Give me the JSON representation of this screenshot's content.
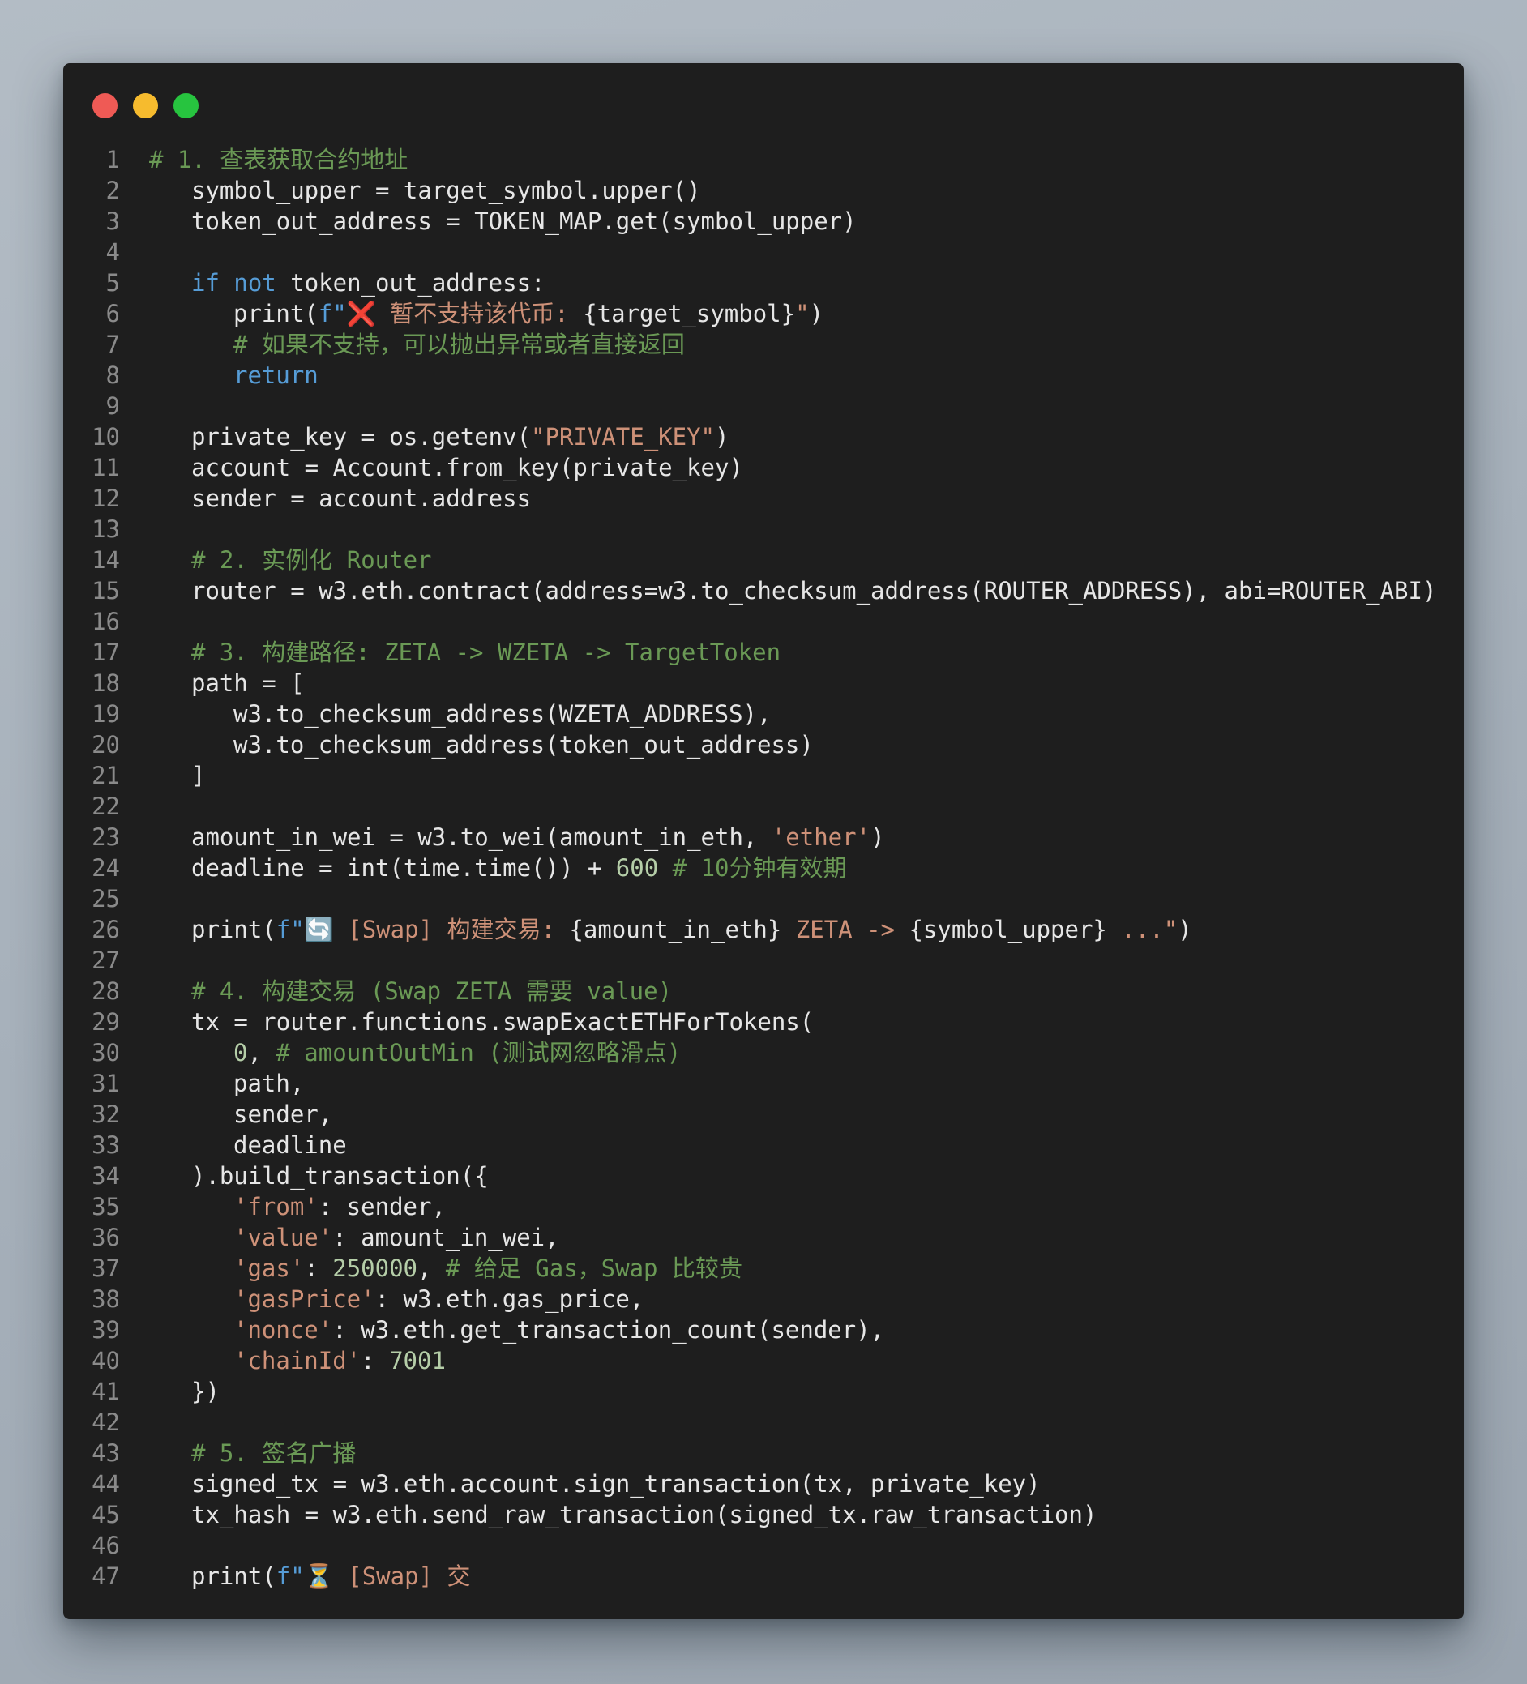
{
  "window": {
    "controls": [
      {
        "name": "close",
        "color": "#ef5a55"
      },
      {
        "name": "minimize",
        "color": "#f6bb2e"
      },
      {
        "name": "maximize",
        "color": "#27c43f"
      }
    ]
  },
  "editor": {
    "language": "python",
    "colors": {
      "background": "#1e1e1e",
      "text": "#e6e6e6",
      "line_number": "#8a8a8a",
      "comment": "#6a9955",
      "keyword": "#569cd6",
      "string": "#ce9178",
      "number": "#b5cea8"
    },
    "lines": [
      {
        "no": "1",
        "indent": 0,
        "tokens": [
          {
            "t": "# 1. 查表获取合约地址",
            "c": "comment"
          }
        ]
      },
      {
        "no": "2",
        "indent": 4,
        "tokens": [
          {
            "t": "symbol_upper = target_symbol.upper()"
          }
        ]
      },
      {
        "no": "3",
        "indent": 4,
        "tokens": [
          {
            "t": "token_out_address = TOKEN_MAP.get(symbol_upper)"
          }
        ]
      },
      {
        "no": "4",
        "indent": 0,
        "tokens": []
      },
      {
        "no": "5",
        "indent": 4,
        "tokens": [
          {
            "t": "if",
            "c": "keyword"
          },
          {
            "t": " "
          },
          {
            "t": "not",
            "c": "keyword"
          },
          {
            "t": " token_out_address:"
          }
        ]
      },
      {
        "no": "6",
        "indent": 8,
        "tokens": [
          {
            "t": "print("
          },
          {
            "t": "f\"",
            "c": "keyword"
          },
          {
            "t": "❌ 暂不支持该代币: ",
            "c": "string"
          },
          {
            "t": "{target_symbol}"
          },
          {
            "t": "\"",
            "c": "string"
          },
          {
            "t": ")"
          }
        ]
      },
      {
        "no": "7",
        "indent": 8,
        "tokens": [
          {
            "t": "# 如果不支持，可以抛出异常或者直接返回",
            "c": "comment"
          }
        ]
      },
      {
        "no": "8",
        "indent": 8,
        "tokens": [
          {
            "t": "return",
            "c": "keyword"
          }
        ]
      },
      {
        "no": "9",
        "indent": 0,
        "tokens": []
      },
      {
        "no": "10",
        "indent": 4,
        "tokens": [
          {
            "t": "private_key = os.getenv("
          },
          {
            "t": "\"PRIVATE_KEY\"",
            "c": "string"
          },
          {
            "t": ")"
          }
        ]
      },
      {
        "no": "11",
        "indent": 4,
        "tokens": [
          {
            "t": "account = Account.from_key(private_key)"
          }
        ]
      },
      {
        "no": "12",
        "indent": 4,
        "tokens": [
          {
            "t": "sender = account.address"
          }
        ]
      },
      {
        "no": "13",
        "indent": 0,
        "tokens": []
      },
      {
        "no": "14",
        "indent": 4,
        "tokens": [
          {
            "t": "# 2. 实例化 Router",
            "c": "comment"
          }
        ]
      },
      {
        "no": "15",
        "indent": 4,
        "tokens": [
          {
            "t": "router = w3.eth.contract(address=w3.to_checksum_address(ROUTER_ADDRESS), abi=ROUTER_ABI)"
          }
        ]
      },
      {
        "no": "16",
        "indent": 0,
        "tokens": []
      },
      {
        "no": "17",
        "indent": 4,
        "tokens": [
          {
            "t": "# 3. 构建路径: ZETA -> WZETA -> TargetToken",
            "c": "comment"
          }
        ]
      },
      {
        "no": "18",
        "indent": 4,
        "tokens": [
          {
            "t": "path = ["
          }
        ]
      },
      {
        "no": "19",
        "indent": 8,
        "tokens": [
          {
            "t": "w3.to_checksum_address(WZETA_ADDRESS),"
          }
        ]
      },
      {
        "no": "20",
        "indent": 8,
        "tokens": [
          {
            "t": "w3.to_checksum_address(token_out_address)"
          }
        ]
      },
      {
        "no": "21",
        "indent": 4,
        "tokens": [
          {
            "t": "]"
          }
        ]
      },
      {
        "no": "22",
        "indent": 0,
        "tokens": []
      },
      {
        "no": "23",
        "indent": 4,
        "tokens": [
          {
            "t": "amount_in_wei = w3.to_wei(amount_in_eth, "
          },
          {
            "t": "'ether'",
            "c": "string"
          },
          {
            "t": ")"
          }
        ]
      },
      {
        "no": "24",
        "indent": 4,
        "tokens": [
          {
            "t": "deadline = int(time.time()) + "
          },
          {
            "t": "600",
            "c": "number"
          },
          {
            "t": " "
          },
          {
            "t": "# 10分钟有效期",
            "c": "comment"
          }
        ]
      },
      {
        "no": "25",
        "indent": 0,
        "tokens": []
      },
      {
        "no": "26",
        "indent": 4,
        "tokens": [
          {
            "t": "print("
          },
          {
            "t": "f\"",
            "c": "keyword"
          },
          {
            "t": "🔄 [Swap] 构建交易: ",
            "c": "string"
          },
          {
            "t": "{amount_in_eth}"
          },
          {
            "t": " ZETA -> ",
            "c": "string"
          },
          {
            "t": "{symbol_upper}"
          },
          {
            "t": " ...\"",
            "c": "string"
          },
          {
            "t": ")"
          }
        ]
      },
      {
        "no": "27",
        "indent": 0,
        "tokens": []
      },
      {
        "no": "28",
        "indent": 4,
        "tokens": [
          {
            "t": "# 4. 构建交易 (Swap ZETA 需要 value)",
            "c": "comment"
          }
        ]
      },
      {
        "no": "29",
        "indent": 4,
        "tokens": [
          {
            "t": "tx = router.functions.swapExactETHForTokens("
          }
        ]
      },
      {
        "no": "30",
        "indent": 8,
        "tokens": [
          {
            "t": "0",
            "c": "number"
          },
          {
            "t": ", "
          },
          {
            "t": "# amountOutMin (测试网忽略滑点)",
            "c": "comment"
          }
        ]
      },
      {
        "no": "31",
        "indent": 8,
        "tokens": [
          {
            "t": "path,"
          }
        ]
      },
      {
        "no": "32",
        "indent": 8,
        "tokens": [
          {
            "t": "sender,"
          }
        ]
      },
      {
        "no": "33",
        "indent": 8,
        "tokens": [
          {
            "t": "deadline"
          }
        ]
      },
      {
        "no": "34",
        "indent": 4,
        "tokens": [
          {
            "t": ").build_transaction({"
          }
        ]
      },
      {
        "no": "35",
        "indent": 8,
        "tokens": [
          {
            "t": "'from'",
            "c": "string"
          },
          {
            "t": ": sender,"
          }
        ]
      },
      {
        "no": "36",
        "indent": 8,
        "tokens": [
          {
            "t": "'value'",
            "c": "string"
          },
          {
            "t": ": amount_in_wei,"
          }
        ]
      },
      {
        "no": "37",
        "indent": 8,
        "tokens": [
          {
            "t": "'gas'",
            "c": "string"
          },
          {
            "t": ": "
          },
          {
            "t": "250000",
            "c": "number"
          },
          {
            "t": ", "
          },
          {
            "t": "# 给足 Gas，Swap 比较贵",
            "c": "comment"
          }
        ]
      },
      {
        "no": "38",
        "indent": 8,
        "tokens": [
          {
            "t": "'gasPrice'",
            "c": "string"
          },
          {
            "t": ": w3.eth.gas_price,"
          }
        ]
      },
      {
        "no": "39",
        "indent": 8,
        "tokens": [
          {
            "t": "'nonce'",
            "c": "string"
          },
          {
            "t": ": w3.eth.get_transaction_count(sender),"
          }
        ]
      },
      {
        "no": "40",
        "indent": 8,
        "tokens": [
          {
            "t": "'chainId'",
            "c": "string"
          },
          {
            "t": ": "
          },
          {
            "t": "7001",
            "c": "number"
          }
        ]
      },
      {
        "no": "41",
        "indent": 4,
        "tokens": [
          {
            "t": "})"
          }
        ]
      },
      {
        "no": "42",
        "indent": 0,
        "tokens": []
      },
      {
        "no": "43",
        "indent": 4,
        "tokens": [
          {
            "t": "# 5. 签名广播",
            "c": "comment"
          }
        ]
      },
      {
        "no": "44",
        "indent": 4,
        "tokens": [
          {
            "t": "signed_tx = w3.eth.account.sign_transaction(tx, private_key)"
          }
        ]
      },
      {
        "no": "45",
        "indent": 4,
        "tokens": [
          {
            "t": "tx_hash = w3.eth.send_raw_transaction(signed_tx.raw_transaction)"
          }
        ]
      },
      {
        "no": "46",
        "indent": 0,
        "tokens": []
      },
      {
        "no": "47",
        "indent": 4,
        "tokens": [
          {
            "t": "print("
          },
          {
            "t": "f\"",
            "c": "keyword"
          },
          {
            "t": "⏳ [Swap] 交",
            "c": "string"
          }
        ]
      }
    ]
  }
}
